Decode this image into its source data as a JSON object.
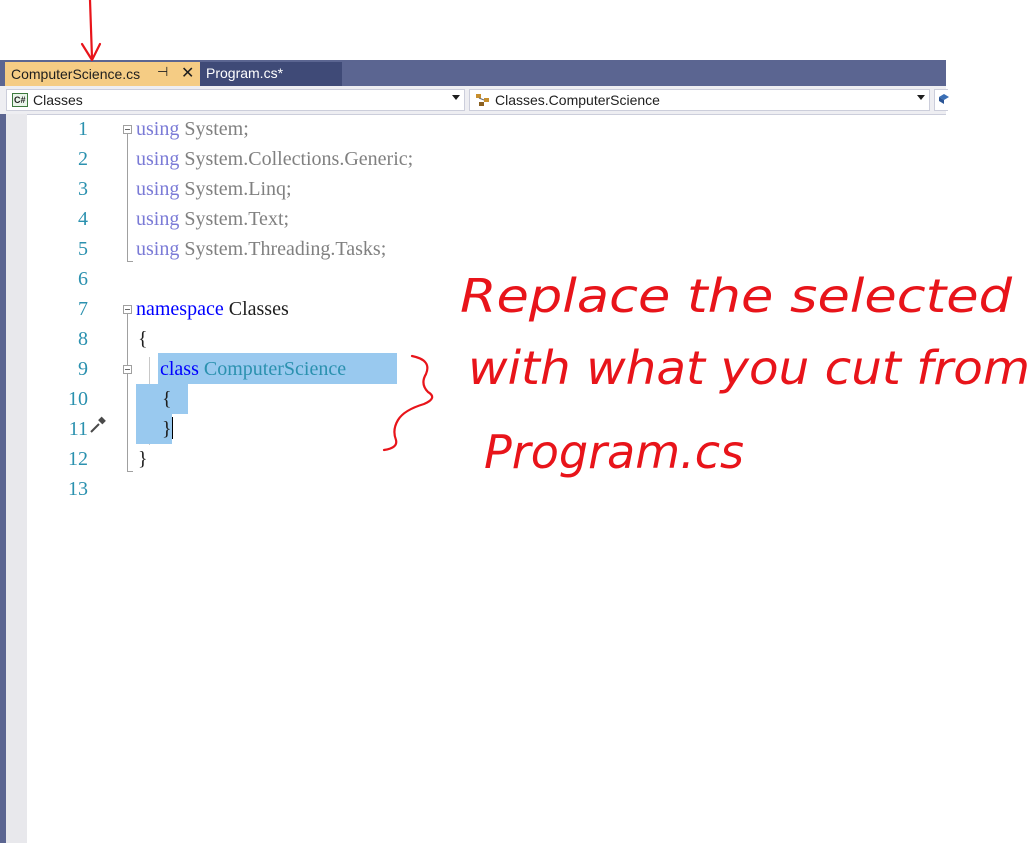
{
  "tabs": [
    {
      "label": "ComputerScience.cs",
      "active": true
    },
    {
      "label": "Program.cs*",
      "active": false
    }
  ],
  "nav": {
    "project_badge": "C#",
    "project": "Classes",
    "type": "Classes.ComputerScience"
  },
  "editor": {
    "line_numbers": [
      "1",
      "2",
      "3",
      "4",
      "5",
      "6",
      "7",
      "8",
      "9",
      "10",
      "11",
      "12",
      "13"
    ],
    "lines": {
      "l1": {
        "kw": "using",
        "rest": " System;"
      },
      "l2": {
        "kw": "using",
        "rest": " System.Collections.Generic;"
      },
      "l3": {
        "kw": "using",
        "rest": " System.Linq;"
      },
      "l4": {
        "kw": "using",
        "rest": " System.Text;"
      },
      "l5": {
        "kw": "using",
        "rest": " System.Threading.Tasks;"
      },
      "l7": {
        "kw": "namespace",
        "rest": " Classes"
      },
      "l8": {
        "text": "{"
      },
      "l9": {
        "kw": "class",
        "type": "ComputerScience"
      },
      "l10": {
        "text": "{"
      },
      "l11": {
        "text": "}"
      },
      "l12": {
        "text": "}"
      }
    }
  },
  "annotation": {
    "line1": "Replace the selected",
    "line2": "with what you cut from",
    "line3": "Program.cs",
    "color": "#e8141a"
  }
}
